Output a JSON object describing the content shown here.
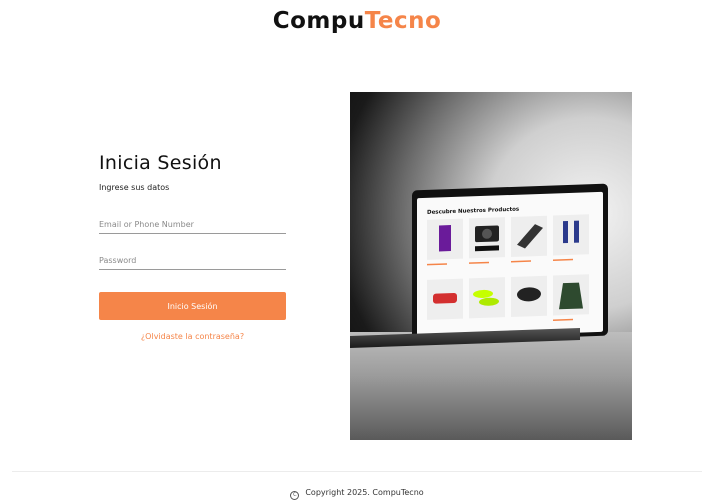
{
  "brand": {
    "part1": "Compu",
    "part2": "Tecno"
  },
  "login": {
    "title": "Inicia Sesión",
    "subtitle": "Ingrese sus datos",
    "email_placeholder": "Email or Phone Number",
    "password_placeholder": "Password",
    "button_label": "Inicio Sesión",
    "forgot_label": "¿Olvidaste la contraseña?"
  },
  "hero": {
    "store_title": "Descubre Nuestros Productos",
    "products": [
      {
        "icon": "phone-box-icon"
      },
      {
        "icon": "camera-icon"
      },
      {
        "icon": "laptop-icon"
      },
      {
        "icon": "chair-icon"
      },
      {
        "icon": "toy-car-icon"
      },
      {
        "icon": "sneaker-icon"
      },
      {
        "icon": "gamepad-icon"
      },
      {
        "icon": "jacket-icon"
      }
    ]
  },
  "footer": {
    "icon": "copyright-icon",
    "text": "Copyright  2025. CompuTecno"
  },
  "colors": {
    "accent": "#f58549",
    "text": "#111111"
  }
}
